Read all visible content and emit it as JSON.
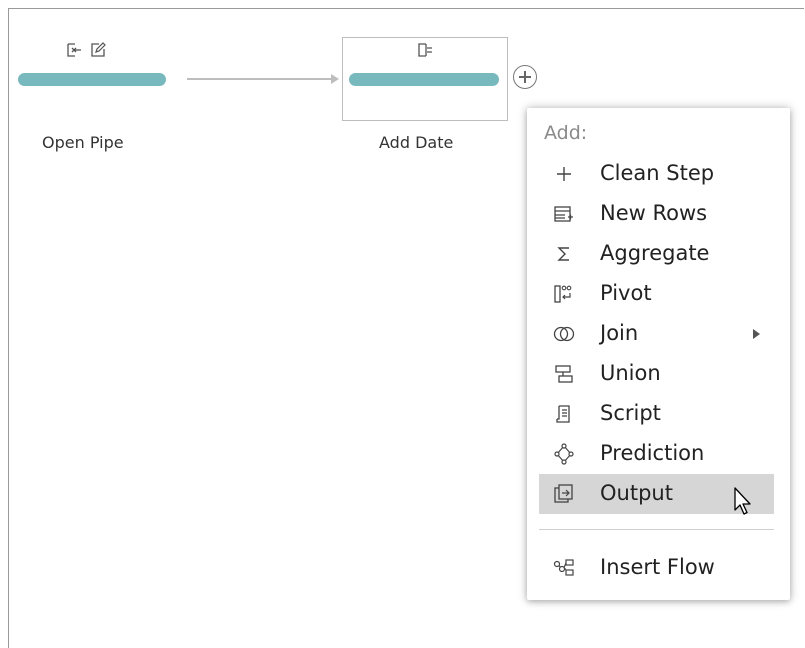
{
  "canvas": {
    "nodes": [
      {
        "id": "open-pipe",
        "label": "Open Pipe",
        "icons": [
          "remove-field-icon",
          "rename-field-icon"
        ]
      },
      {
        "id": "add-date",
        "label": "Add Date",
        "icons": [
          "calculated-field-icon"
        ],
        "selected": true
      }
    ],
    "colors": {
      "node_bar": "#78b9bd",
      "connector": "#bdbdbd"
    }
  },
  "menu": {
    "header": "Add:",
    "items": [
      {
        "label": "Clean Step",
        "icon": "plus-icon"
      },
      {
        "label": "New Rows",
        "icon": "new-rows-icon"
      },
      {
        "label": "Aggregate",
        "icon": "sigma-icon"
      },
      {
        "label": "Pivot",
        "icon": "pivot-icon"
      },
      {
        "label": "Join",
        "icon": "join-icon",
        "submenu": true
      },
      {
        "label": "Union",
        "icon": "union-icon"
      },
      {
        "label": "Script",
        "icon": "script-icon"
      },
      {
        "label": "Prediction",
        "icon": "prediction-icon"
      },
      {
        "label": "Output",
        "icon": "output-icon",
        "active": true
      }
    ],
    "footer_item": {
      "label": "Insert Flow",
      "icon": "insert-flow-icon"
    }
  }
}
